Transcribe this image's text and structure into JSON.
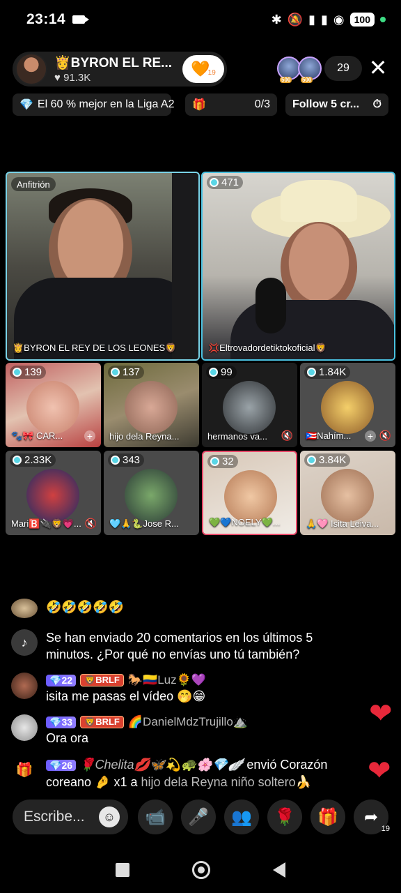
{
  "status_bar": {
    "time": "23:14",
    "battery": "100"
  },
  "host": {
    "name": "👸BYRON EL RE...",
    "likes": "♥ 91.3K",
    "follow_count": "19"
  },
  "viewers": {
    "badge1": "500",
    "badge2": "500",
    "count": "29"
  },
  "pills": {
    "league": "El 60 % mejor en la Liga A2",
    "goal": "0/3",
    "follow": "Follow 5 cr..."
  },
  "tiles": {
    "host": {
      "label": "Anfitrión",
      "name": "👸BYRON EL REY DE LOS LEONES🦁"
    },
    "guest1": {
      "score": "471",
      "name": "💢Eltrovadordetiktokoficial🦁"
    },
    "small": [
      {
        "score": "139",
        "name": "🐾🎀 CAR..."
      },
      {
        "score": "137",
        "name": "hijo dela Reyna..."
      },
      {
        "score": "99",
        "name": "hermanos va..."
      },
      {
        "score": "1.84K",
        "name": "🇵🇷Nahím..."
      },
      {
        "score": "2.33K",
        "name": "Mari🅱️🔌🦁💗..."
      },
      {
        "score": "343",
        "name": "🩵🙏🐍Jose R..."
      },
      {
        "score": "32",
        "name": "💚💙NOELY💚..."
      },
      {
        "score": "3.84K",
        "name": "🙏🩷 Isita Leiva..."
      }
    ]
  },
  "chat": {
    "emoji_row": "🤣🤣🤣🤣🤣",
    "system_msg": "Se han enviado 20 comentarios en los últimos 5 minutos. ¿Por qué no envías uno tú también?",
    "m1": {
      "level": "22",
      "fan": "BRLF",
      "user": "🐎🇨🇴Luz🌻💜",
      "text": "isita me pasas el vídeo 🤭😁"
    },
    "m2": {
      "level": "33",
      "fan": "BRLF",
      "user": "🌈DanielMdzTrujillo⛰️",
      "text": "Ora ora"
    },
    "gift": {
      "level": "26",
      "user": "🌹Chelita💋🦋💫🐢🌸💎🪽",
      "verb": "envió Corazón coreano 🤌 x1 a",
      "to": "hijo dela Reyna niño soltero🍌"
    }
  },
  "input": {
    "placeholder": "Escribe..."
  },
  "share_count": "19"
}
